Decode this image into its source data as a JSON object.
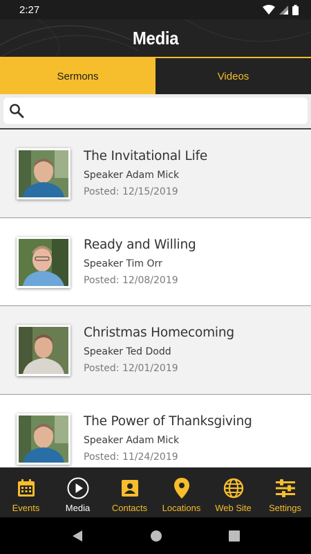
{
  "status_bar": {
    "time": "2:27"
  },
  "header": {
    "title": "Media"
  },
  "tabs": [
    {
      "label": "Sermons",
      "active": true
    },
    {
      "label": "Videos",
      "active": false
    }
  ],
  "search": {
    "placeholder": "",
    "value": ""
  },
  "sermons": [
    {
      "title": "The Invitational Life",
      "speaker": "Speaker Adam Mick",
      "posted": "Posted: 12/15/2019"
    },
    {
      "title": "Ready and Willing",
      "speaker": "Speaker Tim Orr",
      "posted": "Posted: 12/08/2019"
    },
    {
      "title": "Christmas Homecoming",
      "speaker": "Speaker Ted Dodd",
      "posted": "Posted: 12/01/2019"
    },
    {
      "title": "The Power of Thanksgiving",
      "speaker": "Speaker Adam Mick",
      "posted": "Posted: 11/24/2019"
    }
  ],
  "bottom_nav": [
    {
      "label": "Events",
      "icon": "calendar-icon",
      "active": false
    },
    {
      "label": "Media",
      "icon": "play-icon",
      "active": true
    },
    {
      "label": "Contacts",
      "icon": "contact-card-icon",
      "active": false
    },
    {
      "label": "Locations",
      "icon": "map-pin-icon",
      "active": false
    },
    {
      "label": "Web Site",
      "icon": "globe-icon",
      "active": false
    },
    {
      "label": "Settings",
      "icon": "sliders-icon",
      "active": false
    }
  ],
  "colors": {
    "accent": "#f6bd2c",
    "header_bg": "#232323",
    "list_bg": "#f2f2f2"
  }
}
